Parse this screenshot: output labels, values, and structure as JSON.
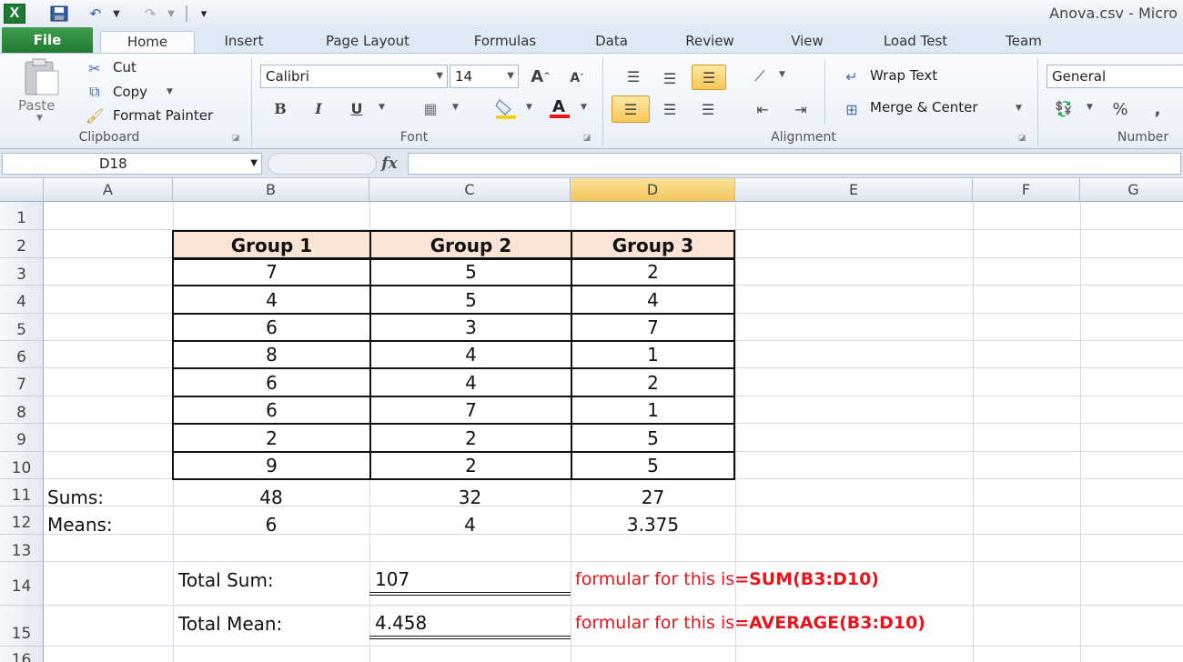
{
  "window": {
    "title": "Anova.csv - Micro",
    "logo": "X"
  },
  "quick_access": {
    "save_icon": "save-icon",
    "undo_icon": "undo-icon",
    "redo_icon": "redo-icon"
  },
  "tabs": [
    {
      "label": "File"
    },
    {
      "label": "Home"
    },
    {
      "label": "Insert"
    },
    {
      "label": "Page Layout"
    },
    {
      "label": "Formulas"
    },
    {
      "label": "Data"
    },
    {
      "label": "Review"
    },
    {
      "label": "View"
    },
    {
      "label": "Load Test"
    },
    {
      "label": "Team"
    }
  ],
  "ribbon": {
    "clipboard": {
      "paste": "Paste",
      "cut": "Cut",
      "copy": "Copy",
      "format_painter": "Format Painter",
      "label": "Clipboard"
    },
    "font": {
      "name": "Calibri",
      "size": "14",
      "bold": "B",
      "italic": "I",
      "underline": "U",
      "label": "Font"
    },
    "alignment": {
      "wrap_text": "Wrap Text",
      "merge_center": "Merge & Center",
      "label": "Alignment"
    },
    "number": {
      "format": "General",
      "percent": "%",
      "comma": ",",
      "label": "Number"
    }
  },
  "formula_bar": {
    "name_box": "D18",
    "fx": "fx",
    "formula": ""
  },
  "columns": [
    "A",
    "B",
    "C",
    "D",
    "E",
    "F",
    "G"
  ],
  "selected_column": "D",
  "rows": [
    "1",
    "2",
    "3",
    "4",
    "5",
    "6",
    "7",
    "8",
    "9",
    "10",
    "11",
    "12",
    "13",
    "14",
    "15",
    "16"
  ],
  "table": {
    "headers": [
      "Group 1",
      "Group 2",
      "Group 3"
    ],
    "data": [
      [
        "7",
        "5",
        "2"
      ],
      [
        "4",
        "5",
        "4"
      ],
      [
        "6",
        "3",
        "7"
      ],
      [
        "8",
        "4",
        "1"
      ],
      [
        "6",
        "4",
        "2"
      ],
      [
        "6",
        "7",
        "1"
      ],
      [
        "2",
        "2",
        "5"
      ],
      [
        "9",
        "2",
        "5"
      ]
    ],
    "sums_label": "Sums:",
    "sums": [
      "48",
      "32",
      "27"
    ],
    "means_label": "Means:",
    "means": [
      "6",
      "4",
      "3.375"
    ]
  },
  "totals": {
    "total_sum_label": "Total Sum:",
    "total_sum": "107",
    "total_sum_note": "formular for this is ",
    "total_sum_formula": "=SUM(B3:D10)",
    "total_mean_label": "Total Mean:",
    "total_mean": "4.458",
    "total_mean_note": "formular for this is ",
    "total_mean_formula": "=AVERAGE(B3:D10)"
  },
  "colors": {
    "file_tab": "#227a32",
    "header_fill": "#fbe4d6",
    "note_text": "#e8141b",
    "selected_col": "#f3c65a"
  }
}
